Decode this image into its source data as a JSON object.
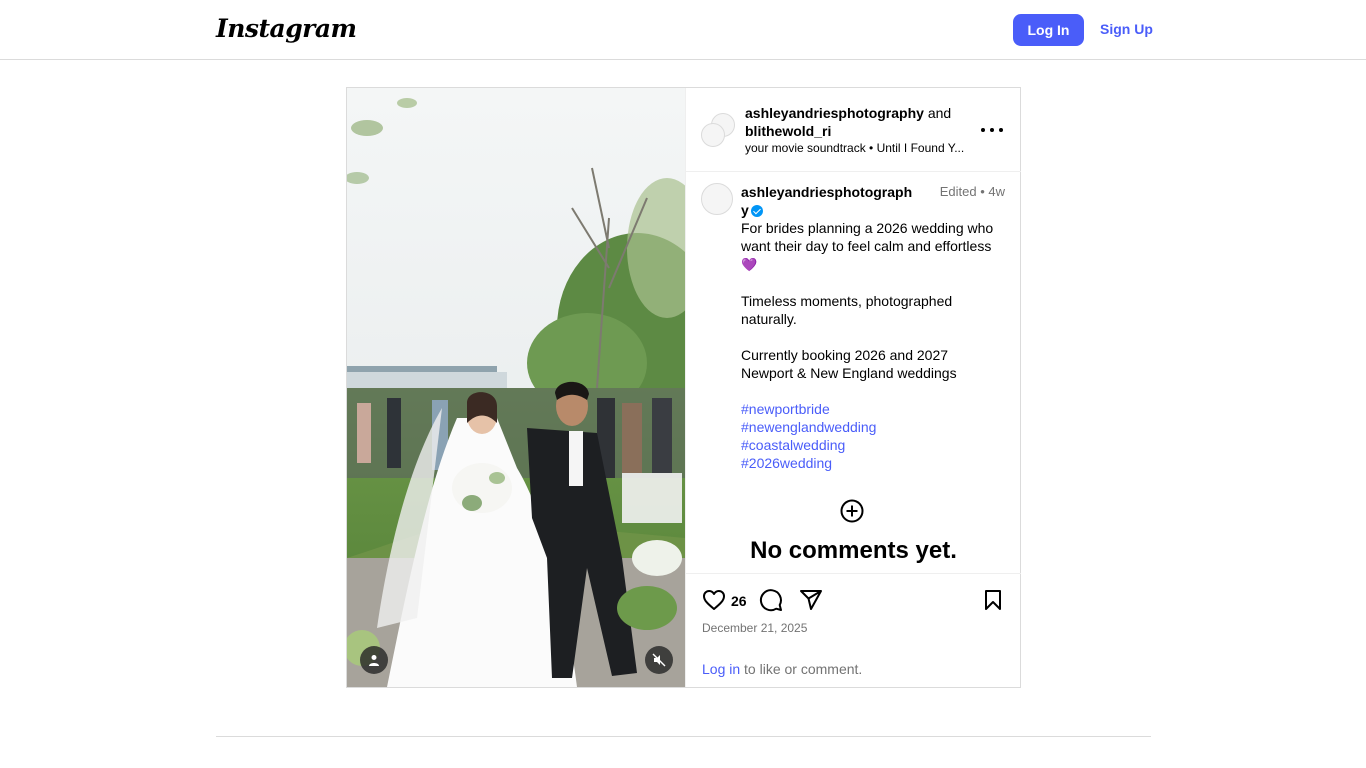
{
  "header": {
    "logo": "Instagram",
    "login_label": "Log In",
    "signup_label": "Sign Up"
  },
  "post": {
    "authors": {
      "primary": "ashleyandriesphotography",
      "joiner": "and",
      "collaborator": "blithewold_ri"
    },
    "audio": "your movie soundtrack • Until I Found Y...",
    "caption": {
      "username": "ashleyandriesphotography",
      "edited": "Edited •",
      "age": "4w",
      "line1": "For brides planning a 2026 wedding who want their day to feel calm and effortless",
      "emoji": "💜",
      "line2": "Timeless moments, photographed naturally.",
      "line3": "Currently booking 2026 and 2027 Newport & New England weddings",
      "hashtags": [
        "#newportbride",
        "#newenglandwedding",
        "#coastalwedding",
        "#2026wedding"
      ]
    },
    "no_comments": "No comments yet.",
    "likes": "26",
    "date": "December 21, 2025",
    "login_prompt": {
      "link": "Log in",
      "rest": " to like or comment."
    }
  },
  "icons": {
    "logo": "instagram-wordmark",
    "more": "more-options-icon",
    "like": "heart-icon",
    "comment": "comment-icon",
    "share": "share-icon",
    "save": "bookmark-icon",
    "add_comment": "plus-circle-icon",
    "user_tags": "user-icon",
    "mute": "muted-speaker-icon"
  },
  "colors": {
    "accent": "#4a5df9",
    "border": "#dbdbdb",
    "muted_text": "#737373",
    "verified": "#0095f6"
  }
}
